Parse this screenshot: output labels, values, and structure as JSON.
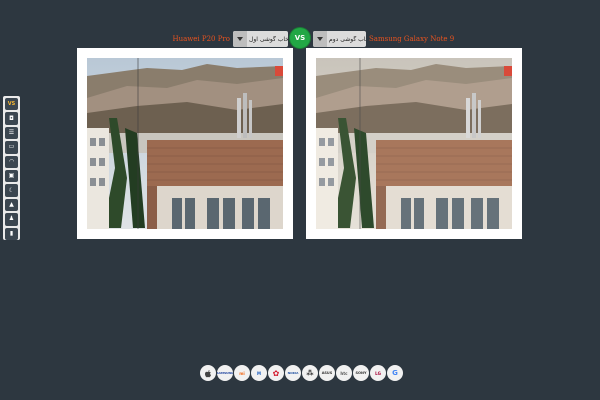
{
  "header": {
    "left_phone": "Huawei P20 Pro",
    "left_select": "انتخاب گوشی اول",
    "vs_label": "VS",
    "right_select": "انتخاب گوشی دوم",
    "right_phone": "Samsung Galaxy Note 9"
  },
  "toolbar": {
    "items": [
      {
        "icon": "vs-icon",
        "glyph": "VS"
      },
      {
        "icon": "camera-icon",
        "glyph": "◘"
      },
      {
        "icon": "menu-icon",
        "glyph": "☰"
      },
      {
        "icon": "screen-icon",
        "glyph": "▭"
      },
      {
        "icon": "speedometer-icon",
        "glyph": "◠"
      },
      {
        "icon": "photo-icon",
        "glyph": "▣"
      },
      {
        "icon": "moon-icon",
        "glyph": "☾"
      },
      {
        "icon": "landscape-icon",
        "glyph": "▲"
      },
      {
        "icon": "portrait-icon",
        "glyph": "♟"
      },
      {
        "icon": "battery-icon",
        "glyph": "▮"
      }
    ]
  },
  "brands": [
    {
      "name": "apple-logo",
      "label": ""
    },
    {
      "name": "samsung-logo",
      "label": "SAMSUNG"
    },
    {
      "name": "xiaomi-logo",
      "label": "mi"
    },
    {
      "name": "motorola-logo",
      "label": "M"
    },
    {
      "name": "huawei-logo",
      "label": "✿"
    },
    {
      "name": "nokia-logo",
      "label": "NOKIA"
    },
    {
      "name": "blackberry-logo",
      "label": "⁂"
    },
    {
      "name": "asus-logo",
      "label": "ASUS"
    },
    {
      "name": "htc-logo",
      "label": "htc"
    },
    {
      "name": "sony-logo",
      "label": "SONY"
    },
    {
      "name": "lg-logo",
      "label": "LG"
    },
    {
      "name": "google-logo",
      "label": "G"
    }
  ]
}
